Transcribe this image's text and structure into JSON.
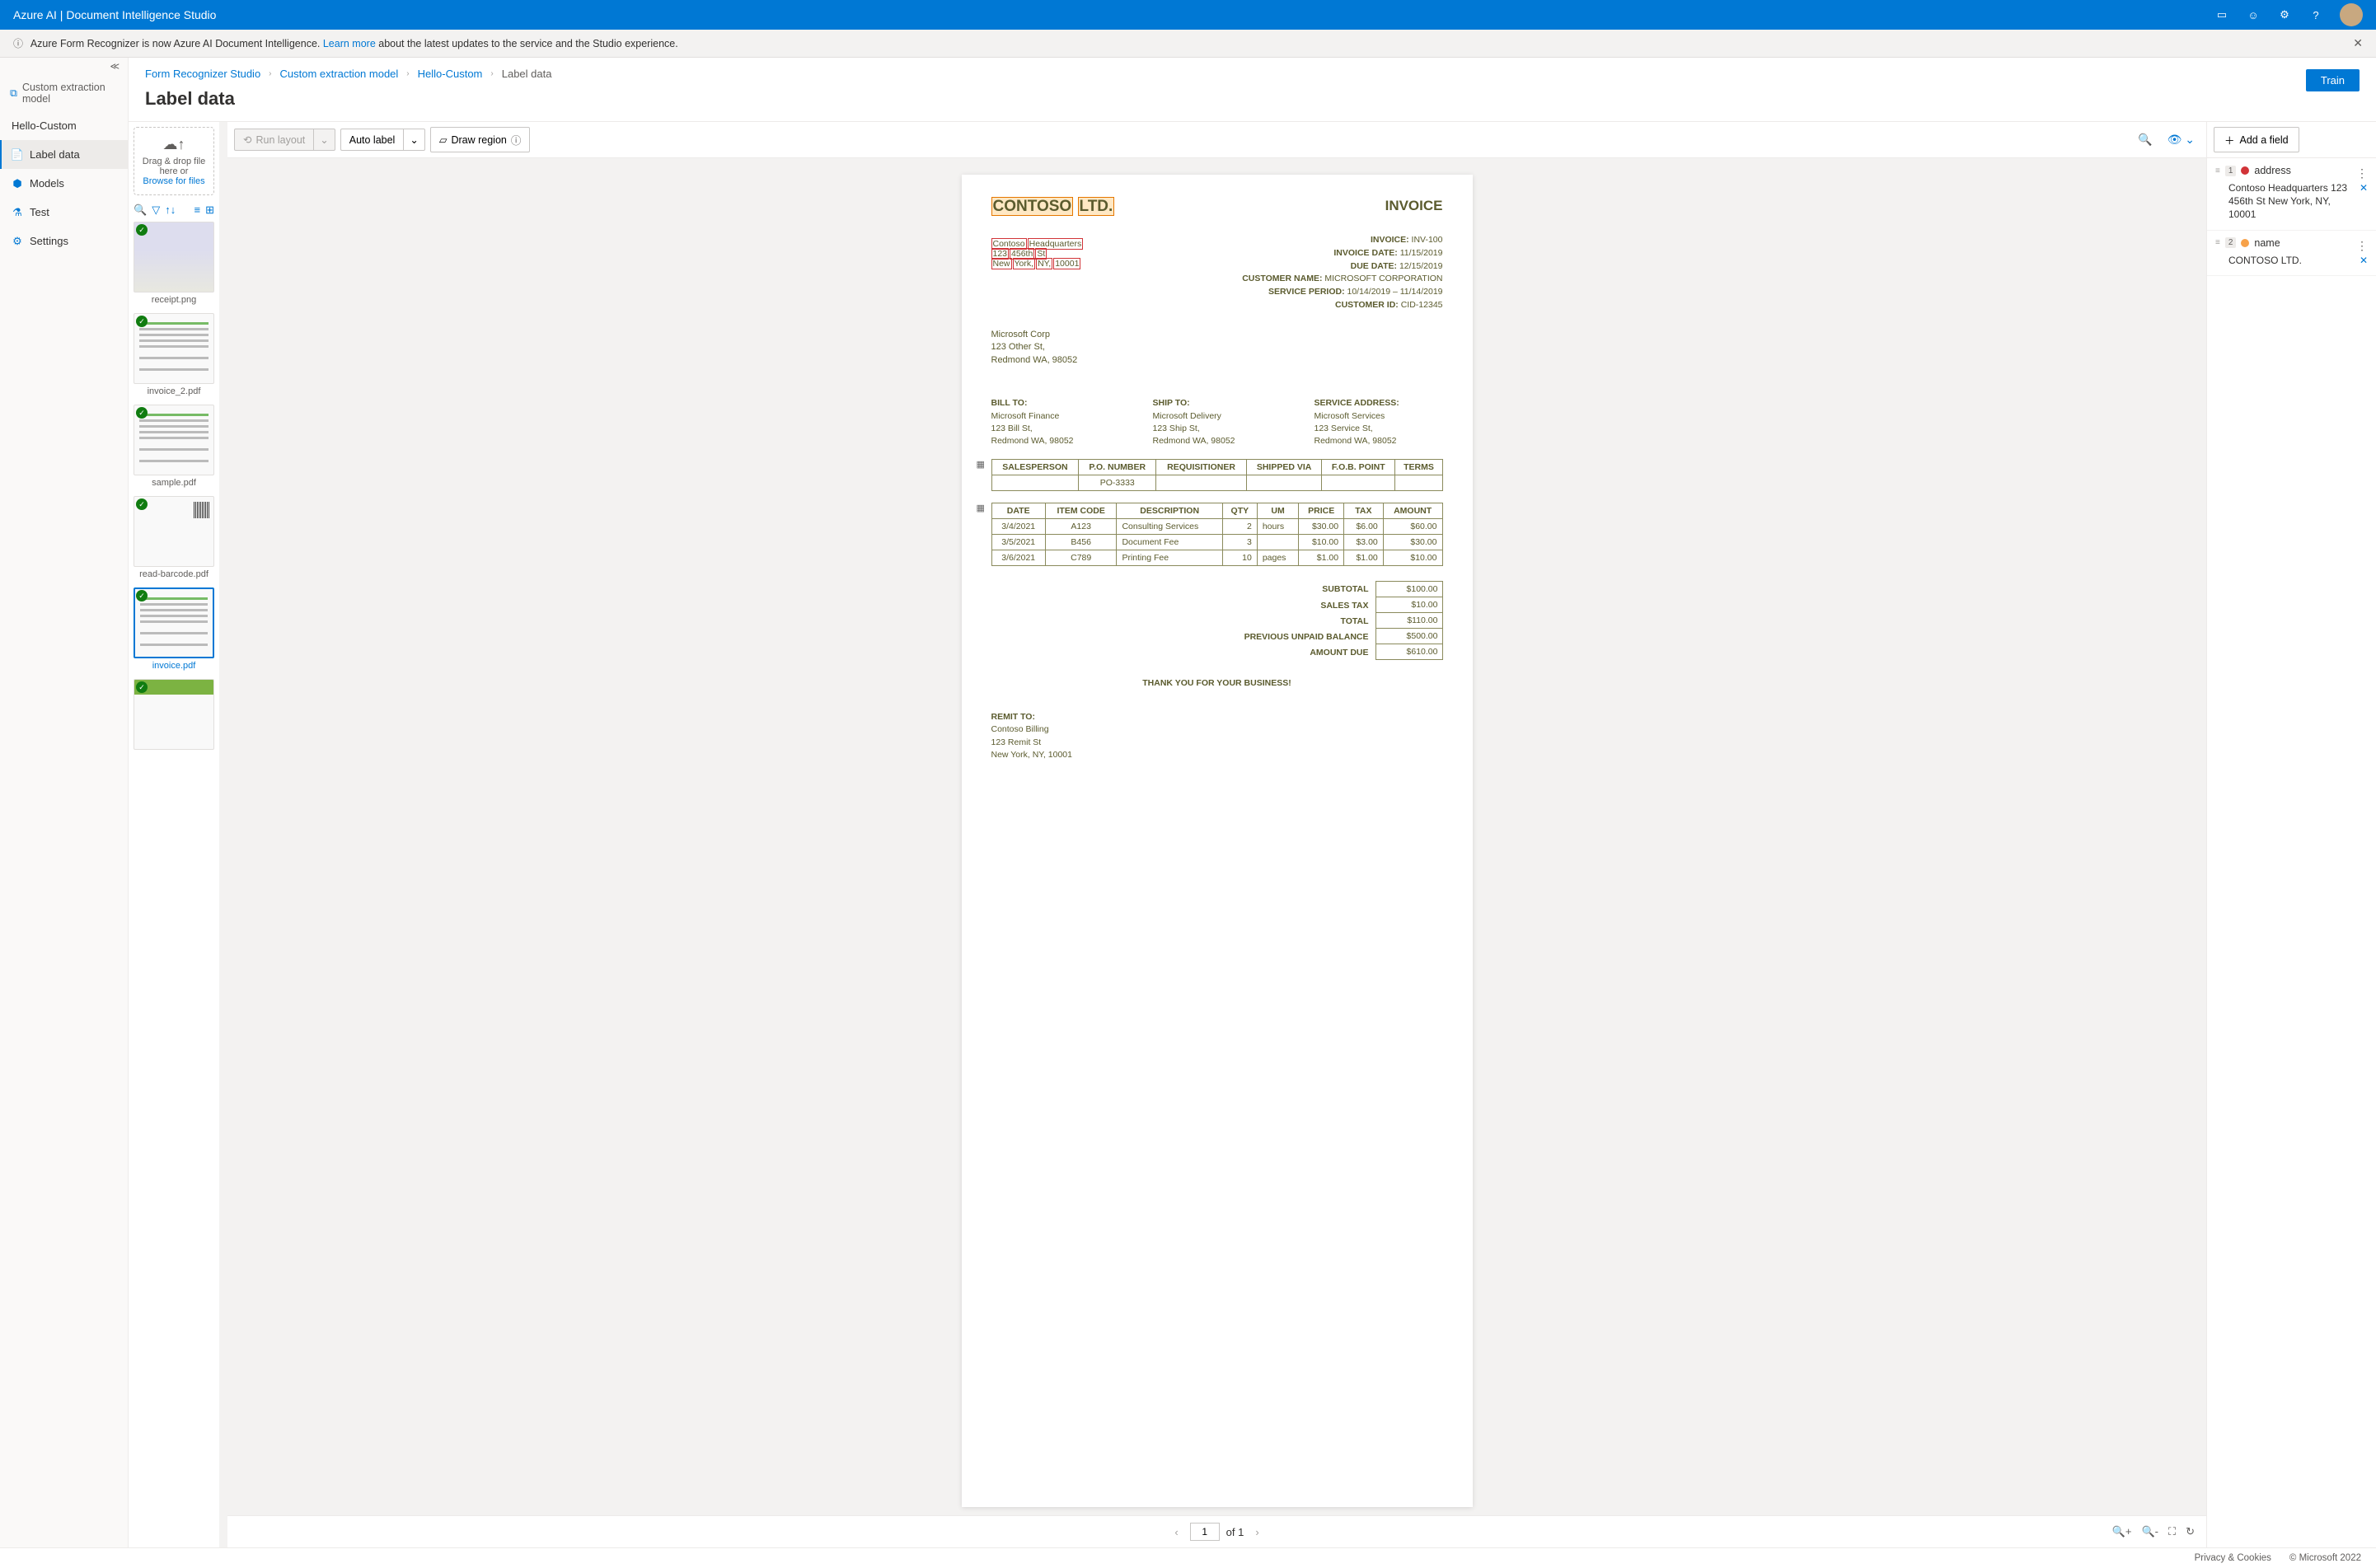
{
  "header": {
    "title": "Azure AI | Document Intelligence Studio"
  },
  "infobar": {
    "prefix": "Azure Form Recognizer is now Azure AI Document Intelligence. ",
    "link": "Learn more",
    "suffix": " about the latest updates to the service and the Studio experience."
  },
  "sidebar": {
    "header": "Custom extraction model",
    "project": "Hello-Custom",
    "items": [
      {
        "label": "Label data",
        "icon": "📄",
        "active": true
      },
      {
        "label": "Models",
        "icon": "⬢",
        "active": false
      },
      {
        "label": "Test",
        "icon": "⚗",
        "active": false
      },
      {
        "label": "Settings",
        "icon": "⚙",
        "active": false
      }
    ]
  },
  "breadcrumb": {
    "items": [
      "Form Recognizer Studio",
      "Custom extraction model",
      "Hello-Custom"
    ],
    "current": "Label data"
  },
  "page_title": "Label data",
  "train_btn": "Train",
  "dropzone": {
    "line1": "Drag & drop file here or",
    "browse": "Browse for files"
  },
  "thumbs": [
    {
      "name": "receipt.png",
      "class": "receipt",
      "checked": true
    },
    {
      "name": "invoice_2.pdf",
      "class": "doc",
      "checked": true
    },
    {
      "name": "sample.pdf",
      "class": "doc",
      "checked": true
    },
    {
      "name": "read-barcode.pdf",
      "class": "barcode",
      "checked": true
    },
    {
      "name": "invoice.pdf",
      "class": "doc",
      "checked": true,
      "selected": true
    },
    {
      "name": "",
      "class": "green",
      "checked": true
    }
  ],
  "toolbar": {
    "run_layout": "Run layout",
    "auto_label": "Auto label",
    "draw_region": "Draw region"
  },
  "doc": {
    "title_words": [
      "CONTOSO",
      "LTD."
    ],
    "invoice_h": "INVOICE",
    "addr_lines": [
      [
        "Contoso",
        "Headquarters"
      ],
      [
        "123",
        "456th",
        "St"
      ],
      [
        "New",
        "York,",
        "NY,",
        "10001"
      ]
    ],
    "meta_lines": [
      [
        "INVOICE:",
        "INV-100"
      ],
      [
        "INVOICE DATE:",
        "11/15/2019"
      ],
      [
        "DUE DATE:",
        "12/15/2019"
      ],
      [
        "CUSTOMER NAME:",
        "MICROSOFT CORPORATION"
      ],
      [
        "SERVICE PERIOD:",
        "10/14/2019 – 11/14/2019"
      ],
      [
        "CUSTOMER ID:",
        "CID-12345"
      ]
    ],
    "vendor_addr": [
      "Microsoft Corp",
      "123 Other St,",
      "Redmond WA, 98052"
    ],
    "blocks": {
      "billto": {
        "h": "BILL TO:",
        "lines": [
          "Microsoft Finance",
          "123 Bill St,",
          "Redmond WA, 98052"
        ]
      },
      "shipto": {
        "h": "SHIP TO:",
        "lines": [
          "Microsoft Delivery",
          "123 Ship St,",
          "Redmond WA, 98052"
        ]
      },
      "service": {
        "h": "SERVICE ADDRESS:",
        "lines": [
          "Microsoft Services",
          "123 Service St,",
          "Redmond WA, 98052"
        ]
      }
    },
    "table1": {
      "headers": [
        "SALESPERSON",
        "P.O. NUMBER",
        "REQUISITIONER",
        "SHIPPED VIA",
        "F.O.B. POINT",
        "TERMS"
      ],
      "row": [
        "",
        "PO-3333",
        "",
        "",
        "",
        ""
      ]
    },
    "table2": {
      "headers": [
        "DATE",
        "ITEM CODE",
        "DESCRIPTION",
        "QTY",
        "UM",
        "PRICE",
        "TAX",
        "AMOUNT"
      ],
      "rows": [
        [
          "3/4/2021",
          "A123",
          "Consulting Services",
          "2",
          "hours",
          "$30.00",
          "$6.00",
          "$60.00"
        ],
        [
          "3/5/2021",
          "B456",
          "Document Fee",
          "3",
          "",
          "$10.00",
          "$3.00",
          "$30.00"
        ],
        [
          "3/6/2021",
          "C789",
          "Printing Fee",
          "10",
          "pages",
          "$1.00",
          "$1.00",
          "$10.00"
        ]
      ]
    },
    "totals": [
      [
        "SUBTOTAL",
        "$100.00"
      ],
      [
        "SALES TAX",
        "$10.00"
      ],
      [
        "TOTAL",
        "$110.00"
      ],
      [
        "PREVIOUS UNPAID BALANCE",
        "$500.00"
      ],
      [
        "AMOUNT DUE",
        "$610.00"
      ]
    ],
    "thankyou": "THANK YOU FOR YOUR BUSINESS!",
    "remit": {
      "h": "REMIT TO:",
      "lines": [
        "Contoso Billing",
        "123 Remit St",
        "New York, NY, 10001"
      ]
    }
  },
  "pager": {
    "page": "1",
    "of": "of 1"
  },
  "fields_panel": {
    "add_field": "Add a field",
    "fields": [
      {
        "num": "1",
        "color": "red",
        "name": "address",
        "value": "Contoso Headquarters 123 456th St New York, NY, 10001"
      },
      {
        "num": "2",
        "color": "orange",
        "name": "name",
        "value": "CONTOSO LTD."
      }
    ]
  },
  "footer": {
    "privacy": "Privacy & Cookies",
    "copyright": "© Microsoft 2022"
  }
}
